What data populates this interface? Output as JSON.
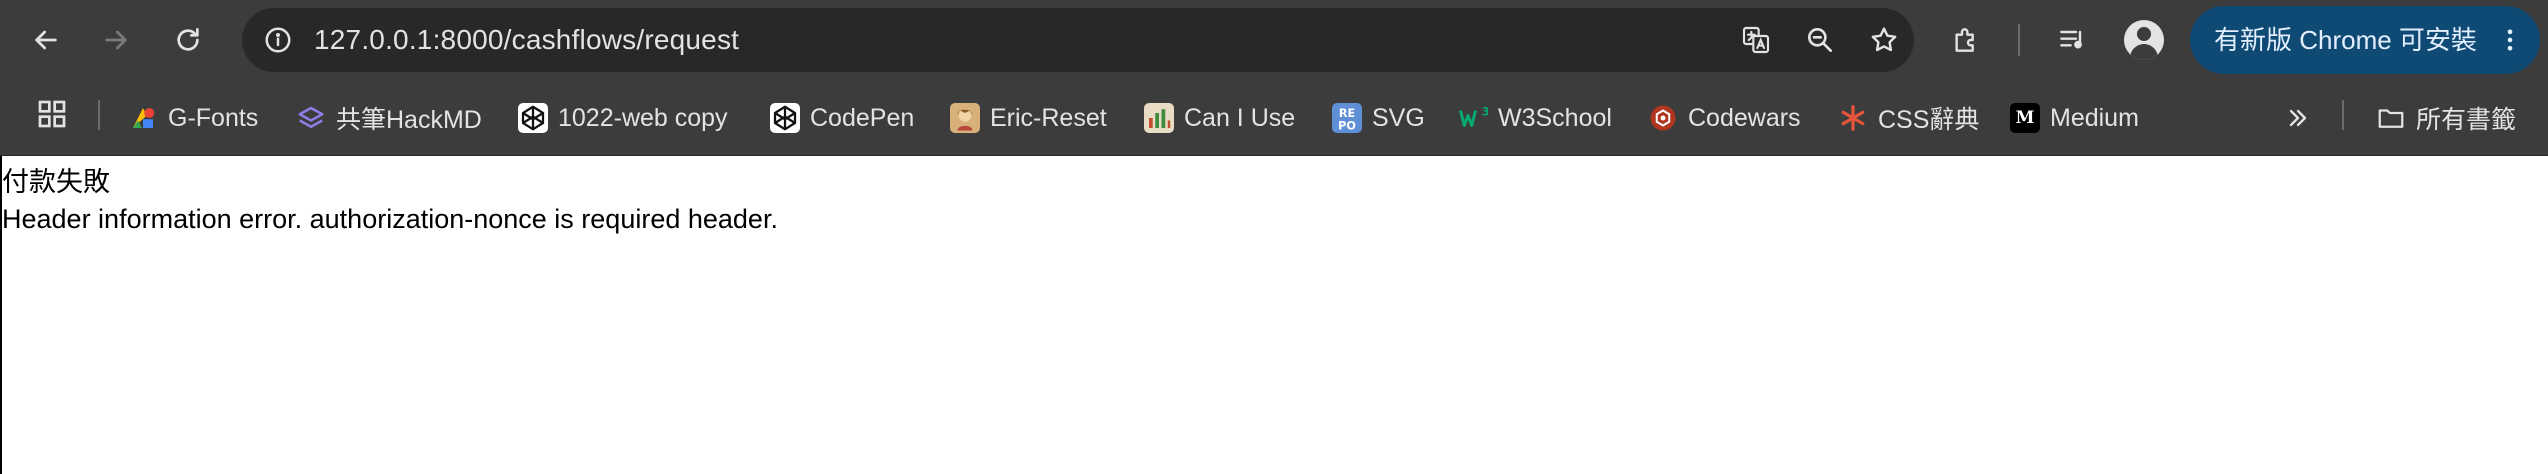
{
  "toolbar": {
    "back_icon": "arrow-left-icon",
    "forward_icon": "arrow-right-icon",
    "reload_icon": "reload-icon",
    "url": "127.0.0.1:8000/cashflows/request",
    "update_button_label": "有新版 Chrome 可安裝"
  },
  "bookmarks": {
    "items": [
      {
        "label": "G-Fonts",
        "icon": "google-fonts-icon"
      },
      {
        "label": "共筆HackMD",
        "icon": "hackmd-icon"
      },
      {
        "label": "1022-web copy",
        "icon": "codepen-icon"
      },
      {
        "label": "CodePen",
        "icon": "codepen-icon"
      },
      {
        "label": "Eric-Reset",
        "icon": "eric-reset-icon"
      },
      {
        "label": "Can I Use",
        "icon": "caniuse-icon"
      },
      {
        "label": "SVG",
        "icon": "repo-icon"
      },
      {
        "label": "W3School",
        "icon": "w3school-icon"
      },
      {
        "label": "Codewars",
        "icon": "codewars-icon"
      },
      {
        "label": "CSS辭典",
        "icon": "asterisk-icon"
      },
      {
        "label": "Medium",
        "icon": "medium-icon"
      }
    ],
    "all_bookmarks_label": "所有書籤"
  },
  "page": {
    "title": "付款失敗",
    "message": "Header information error. authorization-nonce is required header."
  },
  "colors": {
    "toolbar_bg": "#3c3c3c",
    "omnibox_bg": "#282828",
    "update_pill_bg": "#0e4a73",
    "toolbar_text": "#e3e3e3",
    "page_text": "#000000"
  }
}
